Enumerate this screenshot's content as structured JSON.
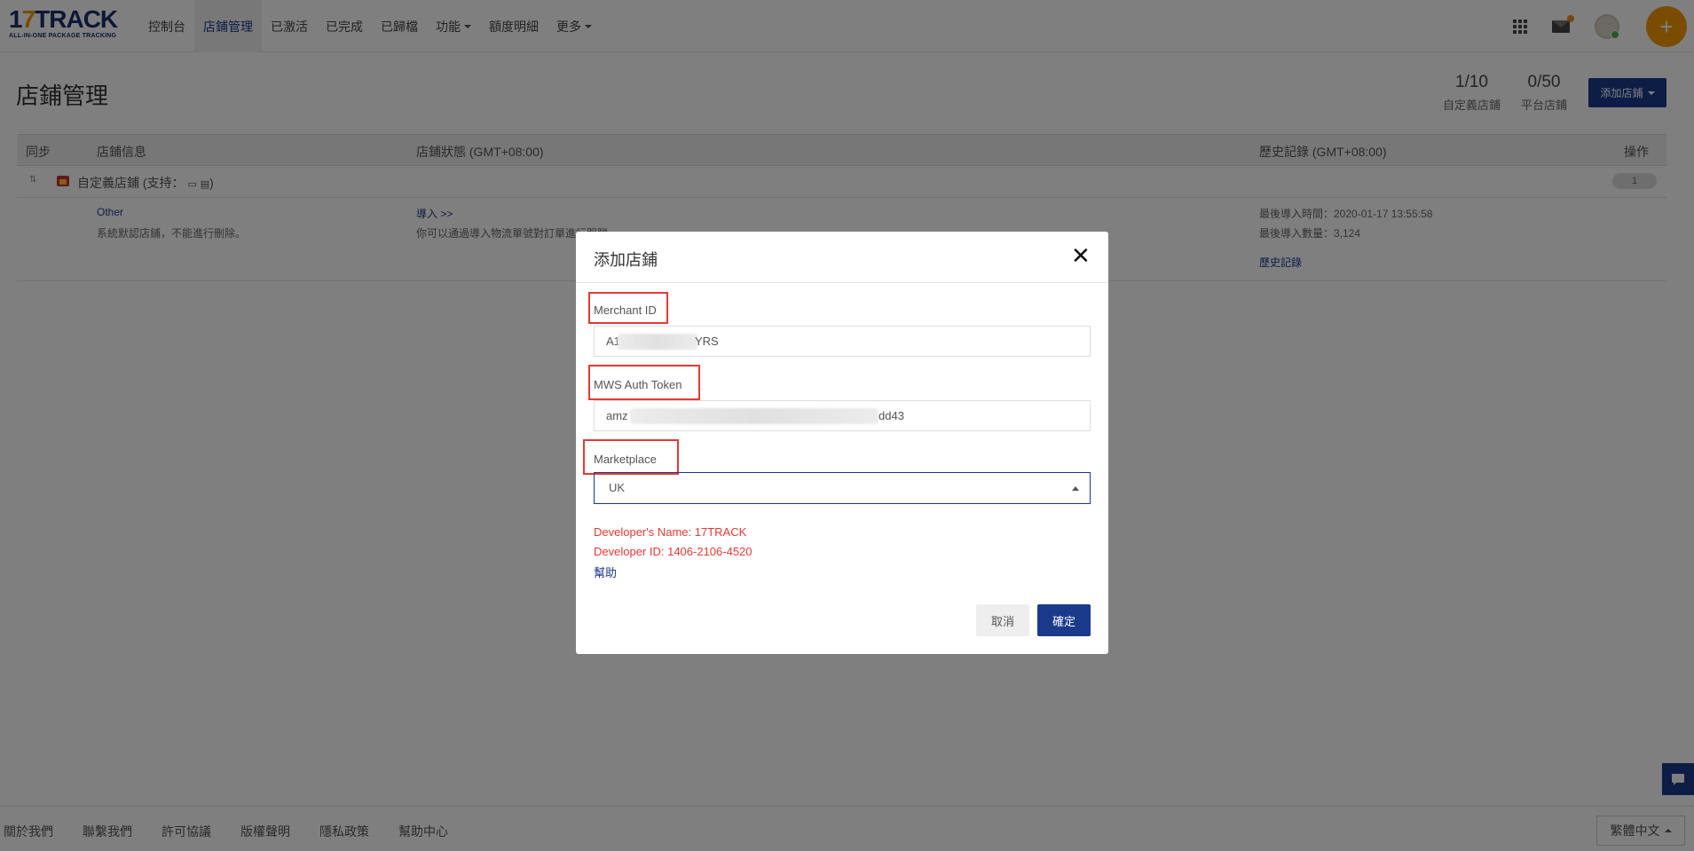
{
  "app": {
    "logo_main": "17TRACK",
    "logo_sub": "ALL-IN-ONE PACKAGE TRACKING"
  },
  "nav": {
    "items": [
      {
        "label": "控制台",
        "active": false,
        "dropdown": false
      },
      {
        "label": "店鋪管理",
        "active": true,
        "dropdown": false
      },
      {
        "label": "已激活",
        "active": false,
        "dropdown": false
      },
      {
        "label": "已完成",
        "active": false,
        "dropdown": false
      },
      {
        "label": "已歸檔",
        "active": false,
        "dropdown": false
      },
      {
        "label": "功能",
        "active": false,
        "dropdown": true
      },
      {
        "label": "額度明細",
        "active": false,
        "dropdown": false
      },
      {
        "label": "更多",
        "active": false,
        "dropdown": true
      }
    ],
    "plus_label": "+"
  },
  "page": {
    "title": "店鋪管理",
    "stats": [
      {
        "value": "1/10",
        "label": "自定義店鋪"
      },
      {
        "value": "0/50",
        "label": "平台店鋪"
      }
    ],
    "add_store_label": "添加店鋪"
  },
  "table": {
    "headers": {
      "sync": "同步",
      "store_info": "店鋪信息",
      "store_status": "店鋪狀態 (GMT+08:00)",
      "history": "歷史記錄 (GMT+08:00)",
      "actions": "操作"
    },
    "group": {
      "label": "自定義店鋪 (支持：",
      "label_end": ")",
      "count": "1"
    },
    "row": {
      "platform": "Other",
      "description": "系統默認店鋪，不能進行刪除。",
      "import_link": "導入 >>",
      "import_desc": "你可以通過導入物流單號對訂單進行跟蹤",
      "last_import_time": "最後導入時間：2020-01-17 13:55:58",
      "last_import_count": "最後導入數量：3,124",
      "history_link": "歷史記錄"
    }
  },
  "modal": {
    "title": "添加店鋪",
    "merchant_id_label": "Merchant ID",
    "merchant_id_value": "A1",
    "merchant_id_value_end": "YRS",
    "token_label": "MWS Auth Token",
    "token_value": "amz",
    "token_value_end": "dd43",
    "marketplace_label": "Marketplace",
    "marketplace_value": "UK",
    "developer_name": "Developer's Name: 17TRACK",
    "developer_id": "Developer ID: 1406-2106-4520",
    "help_link": "幫助",
    "cancel_label": "取消",
    "confirm_label": "確定"
  },
  "footer": {
    "links": [
      "關於我們",
      "聯繫我們",
      "許可協議",
      "版權聲明",
      "隱私政策",
      "幫助中心"
    ],
    "language": "繁體中文"
  },
  "colors": {
    "brand_blue": "#1b3a8c",
    "brand_orange": "#f39800",
    "highlight_red": "#e53935"
  }
}
